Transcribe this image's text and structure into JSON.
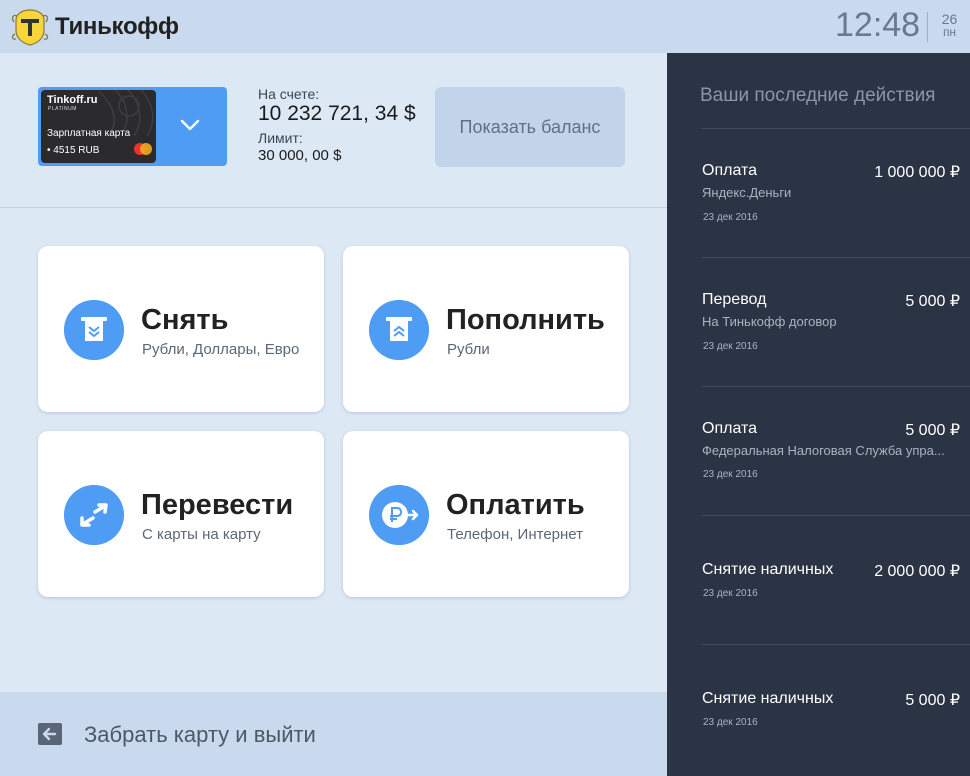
{
  "header": {
    "brand": "Тинькофф",
    "time": "12:48",
    "date_day": "26",
    "date_weekday": "пн"
  },
  "card": {
    "brand": "Tinkoff.ru",
    "tier": "PLATINUM",
    "name": "Зарплатная карта",
    "number": "• 4515 RUB"
  },
  "balance": {
    "label": "На счете:",
    "value": "10 232 721, 34 $",
    "limit_label": "Лимит:",
    "limit_value": "30 000, 00 $",
    "show_button": "Показать баланс"
  },
  "actions": [
    {
      "title": "Снять",
      "subtitle": "Рубли, Доллары, Евро"
    },
    {
      "title": "Пополнить",
      "subtitle": "Рубли"
    },
    {
      "title": "Перевести",
      "subtitle": "С карты на карту"
    },
    {
      "title": "Оплатить",
      "subtitle": "Телефон, Интернет"
    }
  ],
  "exit": {
    "label": "Забрать карту и выйти"
  },
  "history": {
    "title": "Ваши последние действия",
    "items": [
      {
        "name": "Оплата",
        "amount": "1 000 000 ₽",
        "desc": "Яндекс.Деньги",
        "date": "23 дек 2016"
      },
      {
        "name": "Перевод",
        "amount": "5 000 ₽",
        "desc": "На Тинькофф договор",
        "date": "23 дек 2016"
      },
      {
        "name": "Оплата",
        "amount": "5 000 ₽",
        "desc": "Федеральная Налоговая Служба упра...",
        "date": "23 дек 2016"
      },
      {
        "name": "Снятие наличных",
        "amount": "2 000 000 ₽",
        "desc": "",
        "date": "23 дек 2016"
      },
      {
        "name": "Снятие наличных",
        "amount": "5 000 ₽",
        "desc": "",
        "date": "23 дек 2016"
      }
    ]
  },
  "colors": {
    "accent": "#4f9cf5",
    "panel": "#2a3444",
    "background": "#dde8f5",
    "topbar": "#c9daee"
  }
}
